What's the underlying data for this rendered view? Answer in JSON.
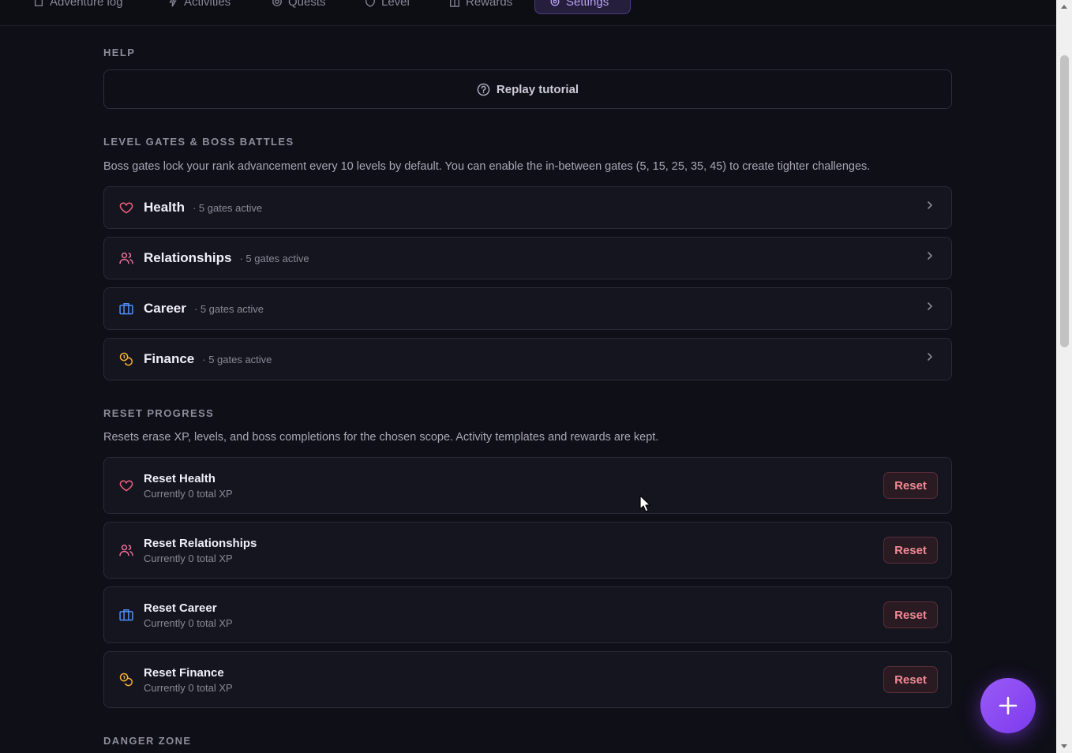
{
  "nav": {
    "tabs": [
      {
        "label": "Adventure log",
        "icon": "book-icon"
      },
      {
        "label": "Activities",
        "icon": "activity-icon"
      },
      {
        "label": "Quests",
        "icon": "target-icon"
      },
      {
        "label": "Level",
        "icon": "shield-icon"
      },
      {
        "label": "Rewards",
        "icon": "gift-icon"
      },
      {
        "label": "Settings",
        "icon": "gear-icon",
        "active": true
      }
    ]
  },
  "help": {
    "title": "HELP",
    "replay_label": "Replay tutorial"
  },
  "gates": {
    "title": "LEVEL GATES & BOSS BATTLES",
    "description": "Boss gates lock your rank advancement every 10 levels by default. You can enable the in-between gates (5, 15, 25, 35, 45) to create tighter challenges.",
    "items": [
      {
        "name": "Health",
        "meta": "· 5 gates active",
        "icon": "heart-icon",
        "color": "#f0627e"
      },
      {
        "name": "Relationships",
        "meta": "· 5 gates active",
        "icon": "users-icon",
        "color": "#ec6f9a"
      },
      {
        "name": "Career",
        "meta": "· 5 gates active",
        "icon": "briefcase-icon",
        "color": "#4f8ef7"
      },
      {
        "name": "Finance",
        "meta": "· 5 gates active",
        "icon": "coins-icon",
        "color": "#f2b134"
      }
    ]
  },
  "reset": {
    "title": "RESET PROGRESS",
    "description": "Resets erase XP, levels, and boss completions for the chosen scope. Activity templates and rewards are kept.",
    "button_label": "Reset",
    "items": [
      {
        "name": "Reset Health",
        "sub": "Currently 0 total XP",
        "icon": "heart-icon",
        "color": "#f0627e"
      },
      {
        "name": "Reset Relationships",
        "sub": "Currently 0 total XP",
        "icon": "users-icon",
        "color": "#ec6f9a"
      },
      {
        "name": "Reset Career",
        "sub": "Currently 0 total XP",
        "icon": "briefcase-icon",
        "color": "#4f8ef7"
      },
      {
        "name": "Reset Finance",
        "sub": "Currently 0 total XP",
        "icon": "coins-icon",
        "color": "#f2b134"
      }
    ]
  },
  "danger": {
    "title": "DANGER ZONE"
  },
  "colors": {
    "accent": "#8b5cf6",
    "danger": "#f08a96",
    "background": "#0f0f17"
  }
}
